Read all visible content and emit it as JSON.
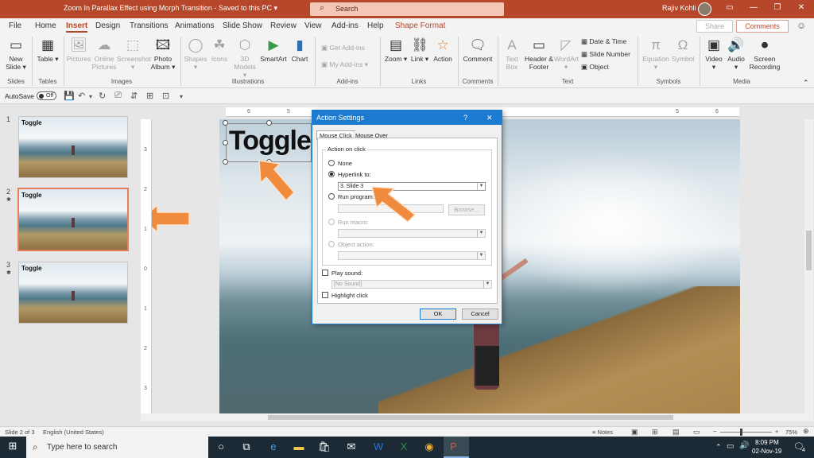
{
  "window": {
    "title": "Zoom In Parallax Effect using Morph Transition  -  Saved to this PC  ▾",
    "search_placeholder": "Search",
    "user": "Rajiv Kohli",
    "icons": {
      "search": "search-icon",
      "minimize": "minimize-icon",
      "restore": "restore-icon",
      "close": "close-icon"
    }
  },
  "tabs": [
    "File",
    "Home",
    "Insert",
    "Design",
    "Transitions",
    "Animations",
    "Slide Show",
    "Review",
    "View",
    "Add-ins",
    "Help",
    "Shape Format"
  ],
  "active_tab": "Insert",
  "header_buttons": {
    "share": "Share",
    "comments": "Comments"
  },
  "ribbon": {
    "slides": {
      "new_slide": "New Slide ▾",
      "group": "Slides"
    },
    "tables": {
      "table": "Table ▾",
      "group": "Tables"
    },
    "images": {
      "pictures": "Pictures",
      "online_pictures": "Online Pictures",
      "screenshot": "Screenshot ▾",
      "photo_album": "Photo Album ▾",
      "group": "Images"
    },
    "illustrations": {
      "shapes": "Shapes ▾",
      "icons": "Icons",
      "models": "3D Models ▾",
      "smartart": "SmartArt",
      "chart": "Chart",
      "group": "Illustrations"
    },
    "addins": {
      "get": "Get Add-ins",
      "my": "My Add-ins ▾",
      "group": "Add-ins"
    },
    "links": {
      "zoom": "Zoom ▾",
      "link": "Link ▾",
      "action": "Action",
      "group": "Links"
    },
    "comments": {
      "comment": "Comment",
      "group": "Comments"
    },
    "text": {
      "textbox": "Text Box",
      "header_footer": "Header & Footer",
      "wordart": "WordArt ▾",
      "date_time": "Date & Time",
      "slide_number": "Slide Number",
      "object": "Object",
      "group": "Text"
    },
    "symbols": {
      "equation": "Equation ▾",
      "symbol": "Symbol",
      "group": "Symbols"
    },
    "media": {
      "video": "Video ▾",
      "audio": "Audio ▾",
      "screen_recording": "Screen Recording",
      "group": "Media"
    }
  },
  "qat": {
    "autosave": "AutoSave",
    "toggle": "Off"
  },
  "thumbnails": [
    {
      "num": "1",
      "title": "Toggle"
    },
    {
      "num": "2",
      "title": "Toggle",
      "star": "✱"
    },
    {
      "num": "3",
      "title": "Toggle",
      "star": "✱"
    }
  ],
  "ruler_h": [
    "6",
    "5",
    "4",
    "3",
    "2",
    "1",
    "0",
    "1",
    "2",
    "3",
    "4",
    "5",
    "6"
  ],
  "ruler_v": [
    "3",
    "2",
    "1",
    "0",
    "1",
    "2",
    "3"
  ],
  "slide": {
    "textbox": "Toggle"
  },
  "dialog": {
    "title": "Action Settings",
    "help": "?",
    "close": "✕",
    "tab_click": "Mouse Click",
    "tab_over": "Mouse Over",
    "group": "Action on click",
    "none": "None",
    "hyperlink": "Hyperlink to:",
    "hyperlink_value": "3. Slide 3",
    "run_program": "Run program:",
    "browse": "Browse...",
    "run_macro": "Run macro:",
    "object_action": "Object action:",
    "play_sound": "Play sound:",
    "sound_value": "[No Sound]",
    "highlight": "Highlight click",
    "ok": "OK",
    "cancel": "Cancel"
  },
  "status": {
    "slide": "Slide 2 of 3",
    "language": "English (United States)",
    "notes": "Notes",
    "zoom": "75%"
  },
  "taskbar": {
    "search": "Type here to search",
    "time": "8:09 PM",
    "date": "02-Nov-19",
    "notifications": "4"
  },
  "colors": {
    "accent": "#b7472a",
    "dialog_blue": "#1a7bd0",
    "arrow": "#f08a3c"
  }
}
